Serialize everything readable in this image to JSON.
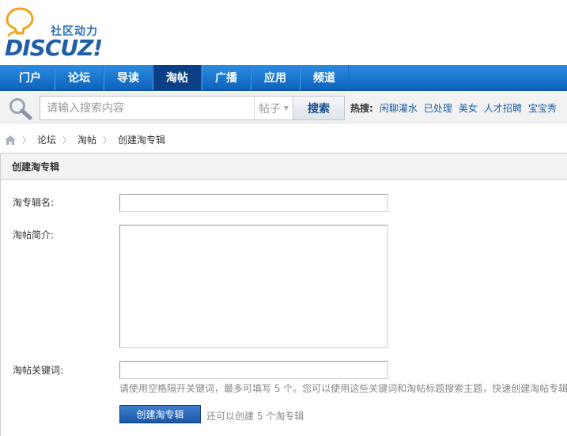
{
  "logo": {
    "tagline": "社区动力",
    "wordmark": "DISCUZ",
    "wordmark_bang": "!"
  },
  "nav": {
    "items": [
      {
        "label": "门户",
        "active": false
      },
      {
        "label": "论坛",
        "active": false
      },
      {
        "label": "导读",
        "active": false
      },
      {
        "label": "淘帖",
        "active": true
      },
      {
        "label": "广播",
        "active": false
      },
      {
        "label": "应用",
        "active": false
      },
      {
        "label": "频道",
        "active": false
      }
    ]
  },
  "search": {
    "placeholder": "请输入搜索内容",
    "type": "帖子",
    "button": "搜索",
    "hot_label": "热搜:",
    "hot_links": [
      "闲聊灌水",
      "已处理",
      "美女",
      "人才招聘",
      "宝宝秀"
    ]
  },
  "breadcrumb": {
    "items": [
      "论坛",
      "淘帖",
      "创建淘专辑"
    ]
  },
  "panel": {
    "title": "创建淘专辑",
    "name_label": "淘专辑名:",
    "name_value": "",
    "intro_label": "淘帖简介:",
    "intro_value": "",
    "keywords_label": "淘帖关键词:",
    "keywords_value": "",
    "hint": "请使用空格隔开关键词，最多可填写 5 个。您可以使用这些关键词和淘帖标题搜索主题，快速创建淘帖专辑",
    "submit": "创建淘专辑",
    "remaining": "还可以创建 5 个淘专辑"
  },
  "colors": {
    "nav_bg": "#1b74cf",
    "nav_active": "#0a3f86",
    "link": "#1f5ea8"
  }
}
